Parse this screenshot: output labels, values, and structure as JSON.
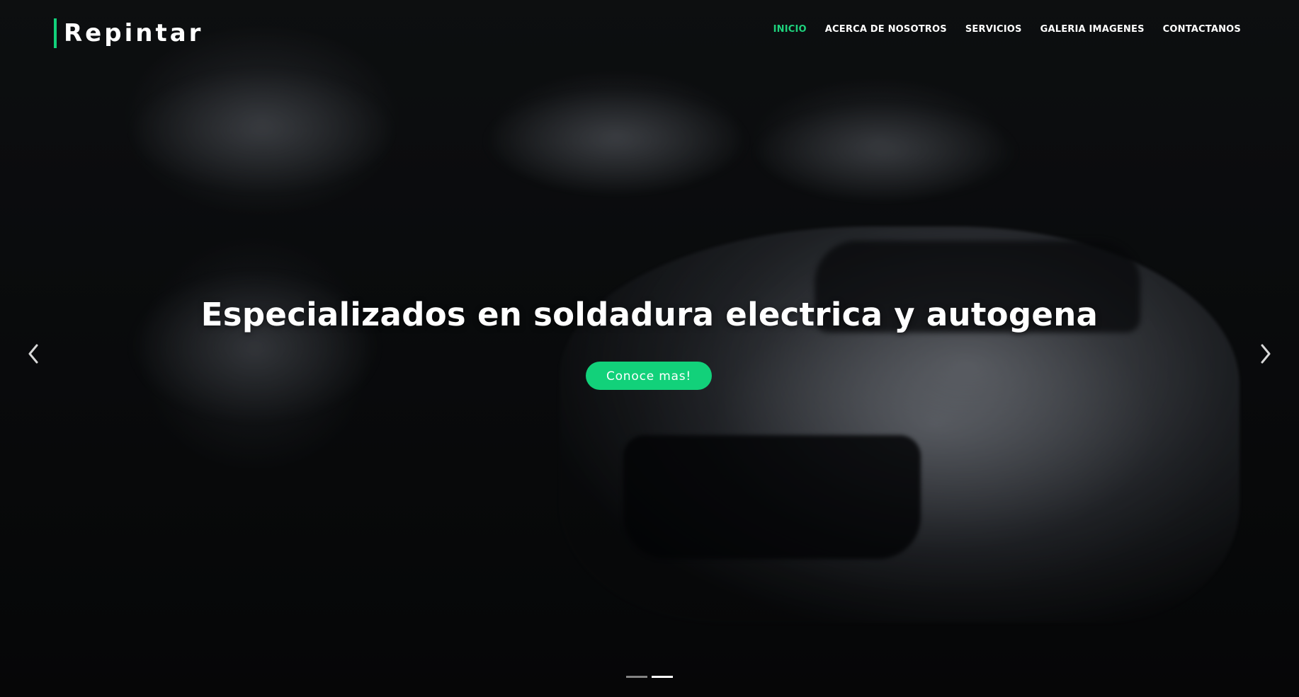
{
  "brand": {
    "name": "Repintar"
  },
  "nav": {
    "items": [
      {
        "label": "INICIO",
        "active": true
      },
      {
        "label": "ACERCA DE NOSOTROS",
        "active": false
      },
      {
        "label": "SERVICIOS",
        "active": false
      },
      {
        "label": "GALERIA IMAGENES",
        "active": false
      },
      {
        "label": "CONTACTANOS",
        "active": false
      }
    ]
  },
  "hero": {
    "headline": "Especializados en soldadura electrica y autogena",
    "cta_label": "Conoce mas!",
    "prev_icon": "chevron-left-icon",
    "next_icon": "chevron-right-icon",
    "slide_count": 2,
    "active_slide": 2
  },
  "colors": {
    "accent": "#12d17a",
    "active_nav": "#1ed27d",
    "text": "#ffffff",
    "background": "#0d0f11"
  }
}
